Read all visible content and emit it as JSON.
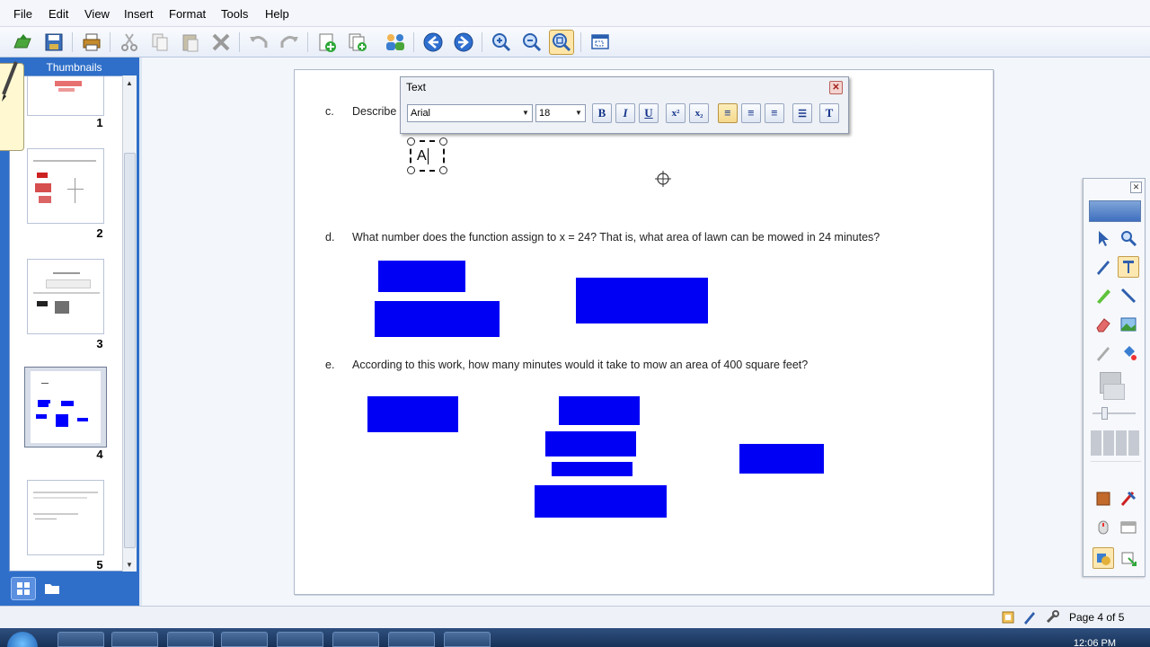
{
  "menu": {
    "items": [
      "File",
      "Edit",
      "View",
      "Insert",
      "Format",
      "Tools",
      "Help"
    ]
  },
  "toolbar": {
    "buttons": [
      "open-icon",
      "save-icon",
      "print-icon",
      "cut-icon",
      "copy-icon",
      "paste-icon",
      "delete-icon",
      "undo-icon",
      "redo-icon",
      "add-page-icon",
      "duplicate-page-icon",
      "share-icon",
      "back-icon",
      "forward-icon",
      "zoom-in-icon",
      "zoom-out-icon",
      "fit-page-icon",
      "screen-capture-icon"
    ]
  },
  "thumbnails": {
    "header": "Thumbnails",
    "pages": [
      {
        "num": "1"
      },
      {
        "num": "2"
      },
      {
        "num": "3"
      },
      {
        "num": "4"
      },
      {
        "num": "5"
      }
    ],
    "selected": 4
  },
  "page": {
    "questions": [
      {
        "letter": "c.",
        "text": "Describe"
      },
      {
        "letter": "d.",
        "text": "What number does the function assign to x = 24?  That is, what area of lawn can be mowed in 24 minutes?"
      },
      {
        "letter": "e.",
        "text": "According to this work, how many minutes would it take to mow an area of 400 square feet?"
      }
    ],
    "textbox_content": "A"
  },
  "text_toolbar": {
    "title": "Text",
    "font": "Arial",
    "size": "18",
    "buttons": [
      {
        "name": "bold-button",
        "label": "B"
      },
      {
        "name": "italic-button",
        "label": "I"
      },
      {
        "name": "underline-button",
        "label": "U"
      },
      {
        "name": "superscript-button",
        "label": "x²"
      },
      {
        "name": "subscript-button",
        "label": "x₂"
      },
      {
        "name": "align-left-button",
        "label": "≡"
      },
      {
        "name": "align-center-button",
        "label": "≡"
      },
      {
        "name": "align-right-button",
        "label": "≡"
      },
      {
        "name": "bullets-button",
        "label": "☰"
      },
      {
        "name": "text-frame-button",
        "label": "T"
      }
    ]
  },
  "status": {
    "page_indicator": "Page 4 of 5"
  },
  "taskbar": {
    "clock": "12:06 PM"
  },
  "colors": {
    "panel_blue": "#2f6fc9",
    "shape_blue": "#0000f5"
  }
}
